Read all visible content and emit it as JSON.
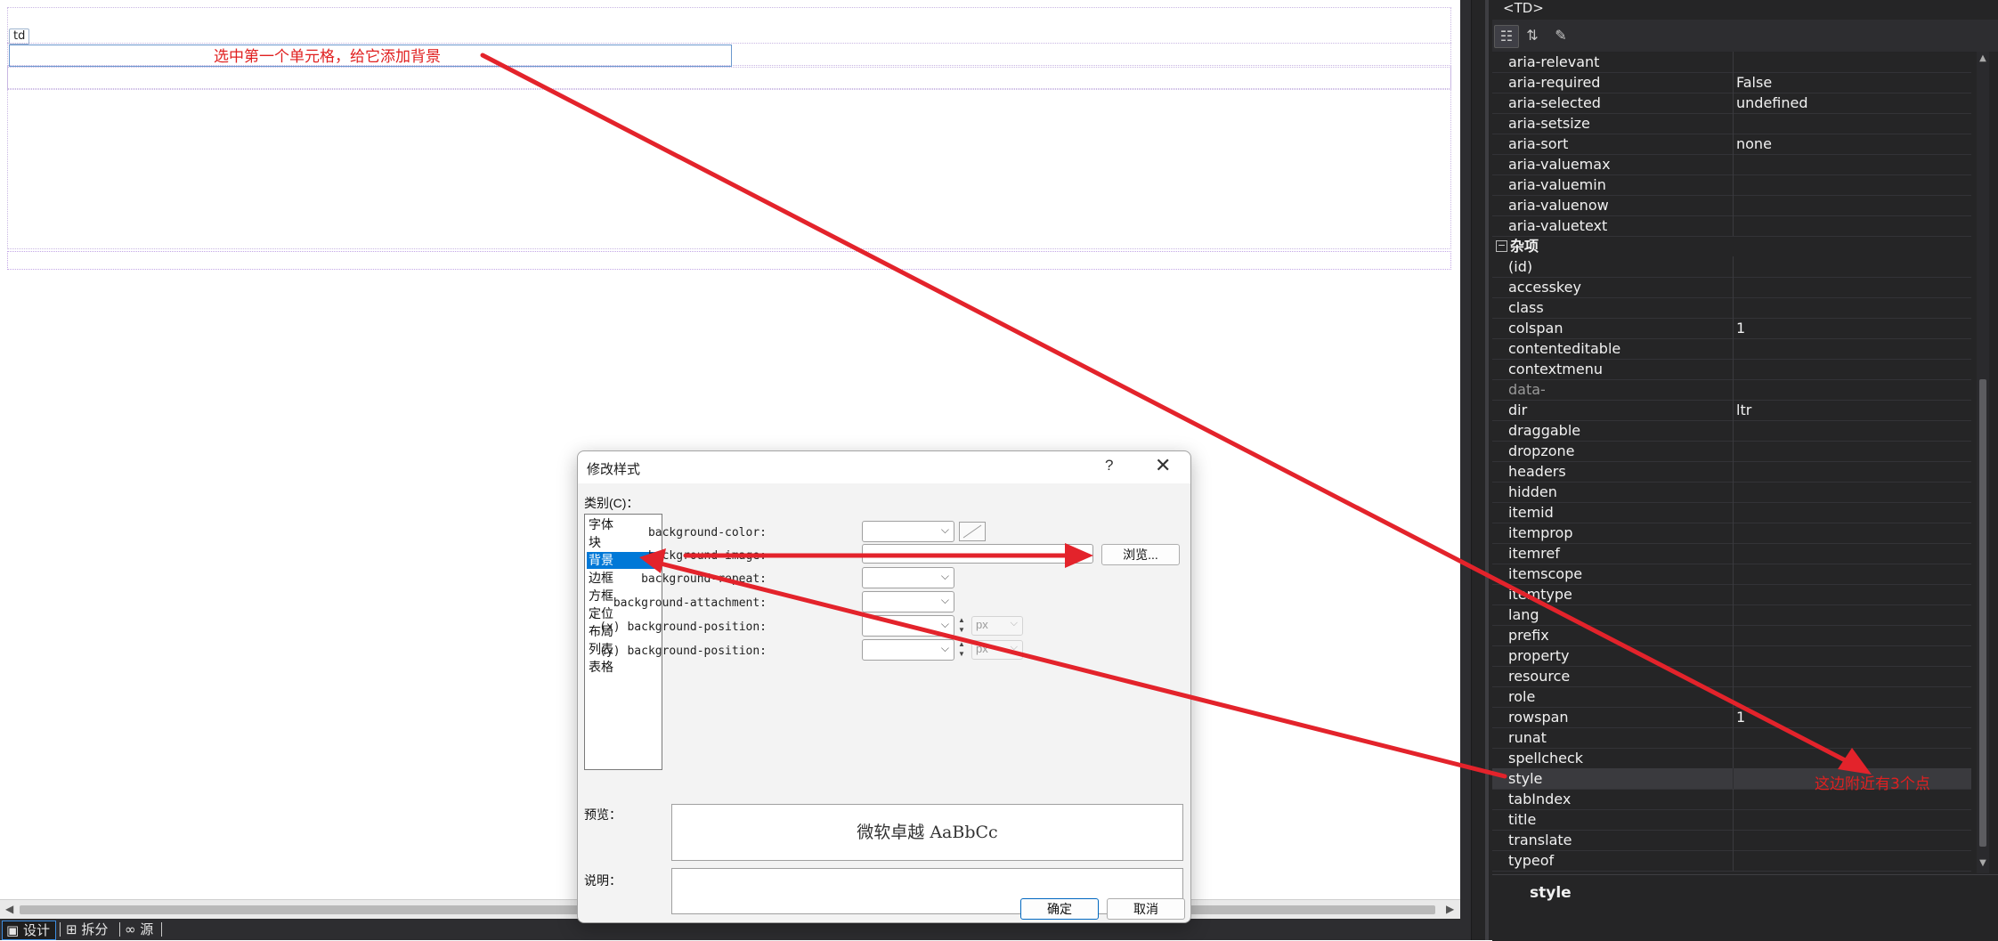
{
  "design": {
    "td_tag": "td",
    "annotation_top": "选中第一个单元格，给它添加背景",
    "annotation_right": "这边附近有3个点"
  },
  "view_tabs": [
    {
      "icon": "design-view-icon",
      "label": "设计",
      "active": true
    },
    {
      "icon": "split-view-icon",
      "label": "拆分",
      "active": false
    },
    {
      "icon": "source-view-icon",
      "label": "源",
      "active": false
    }
  ],
  "properties": {
    "title": "<TD>",
    "groups": [
      {
        "type": "prop",
        "name": "aria-relevant",
        "value": ""
      },
      {
        "type": "prop",
        "name": "aria-required",
        "value": "False"
      },
      {
        "type": "prop",
        "name": "aria-selected",
        "value": "undefined"
      },
      {
        "type": "prop",
        "name": "aria-setsize",
        "value": ""
      },
      {
        "type": "prop",
        "name": "aria-sort",
        "value": "none"
      },
      {
        "type": "prop",
        "name": "aria-valuemax",
        "value": ""
      },
      {
        "type": "prop",
        "name": "aria-valuemin",
        "value": ""
      },
      {
        "type": "prop",
        "name": "aria-valuenow",
        "value": ""
      },
      {
        "type": "prop",
        "name": "aria-valuetext",
        "value": ""
      },
      {
        "type": "category",
        "name": "杂项",
        "toggle": "−"
      },
      {
        "type": "prop",
        "name": "(id)",
        "value": ""
      },
      {
        "type": "prop",
        "name": "accesskey",
        "value": ""
      },
      {
        "type": "prop",
        "name": "class",
        "value": ""
      },
      {
        "type": "prop",
        "name": "colspan",
        "value": "1"
      },
      {
        "type": "prop",
        "name": "contenteditable",
        "value": ""
      },
      {
        "type": "prop",
        "name": "contextmenu",
        "value": ""
      },
      {
        "type": "prop",
        "name": "data-",
        "value": "",
        "dim": true
      },
      {
        "type": "prop",
        "name": "dir",
        "value": "ltr"
      },
      {
        "type": "prop",
        "name": "draggable",
        "value": ""
      },
      {
        "type": "prop",
        "name": "dropzone",
        "value": ""
      },
      {
        "type": "prop",
        "name": "headers",
        "value": ""
      },
      {
        "type": "prop",
        "name": "hidden",
        "value": ""
      },
      {
        "type": "prop",
        "name": "itemid",
        "value": ""
      },
      {
        "type": "prop",
        "name": "itemprop",
        "value": ""
      },
      {
        "type": "prop",
        "name": "itemref",
        "value": ""
      },
      {
        "type": "prop",
        "name": "itemscope",
        "value": ""
      },
      {
        "type": "prop",
        "name": "itemtype",
        "value": ""
      },
      {
        "type": "prop",
        "name": "lang",
        "value": ""
      },
      {
        "type": "prop",
        "name": "prefix",
        "value": ""
      },
      {
        "type": "prop",
        "name": "property",
        "value": ""
      },
      {
        "type": "prop",
        "name": "resource",
        "value": ""
      },
      {
        "type": "prop",
        "name": "role",
        "value": ""
      },
      {
        "type": "prop",
        "name": "rowspan",
        "value": "1"
      },
      {
        "type": "prop",
        "name": "runat",
        "value": ""
      },
      {
        "type": "prop",
        "name": "spellcheck",
        "value": ""
      },
      {
        "type": "prop",
        "name": "style",
        "value": "",
        "selected": true
      },
      {
        "type": "prop",
        "name": "tabIndex",
        "value": ""
      },
      {
        "type": "prop",
        "name": "title",
        "value": ""
      },
      {
        "type": "prop",
        "name": "translate",
        "value": ""
      },
      {
        "type": "prop",
        "name": "typeof",
        "value": ""
      }
    ],
    "description_name": "style"
  },
  "dialog": {
    "title": "修改样式",
    "help": "?",
    "close": "✕",
    "category_label": "类别(C)：",
    "categories": [
      "字体",
      "块",
      "背景",
      "边框",
      "方框",
      "定位",
      "布局",
      "列表",
      "表格"
    ],
    "selected_category": "背景",
    "fields": {
      "bg_color": "background-color:",
      "bg_image": "background-image:",
      "bg_repeat": "background-repeat:",
      "bg_attachment": "background-attachment:",
      "bg_pos_x": "(x) background-position:",
      "bg_pos_y": "(y) background-position:"
    },
    "unit": "px",
    "browse": "浏览...",
    "preview_label": "预览：",
    "preview_text": "微软卓越 AaBbCc",
    "description_label": "说明：",
    "ok": "确定",
    "cancel": "取消"
  },
  "colors": {
    "annotation": "#e02020",
    "selection": "#0078d7",
    "panel_bg": "#252526"
  }
}
